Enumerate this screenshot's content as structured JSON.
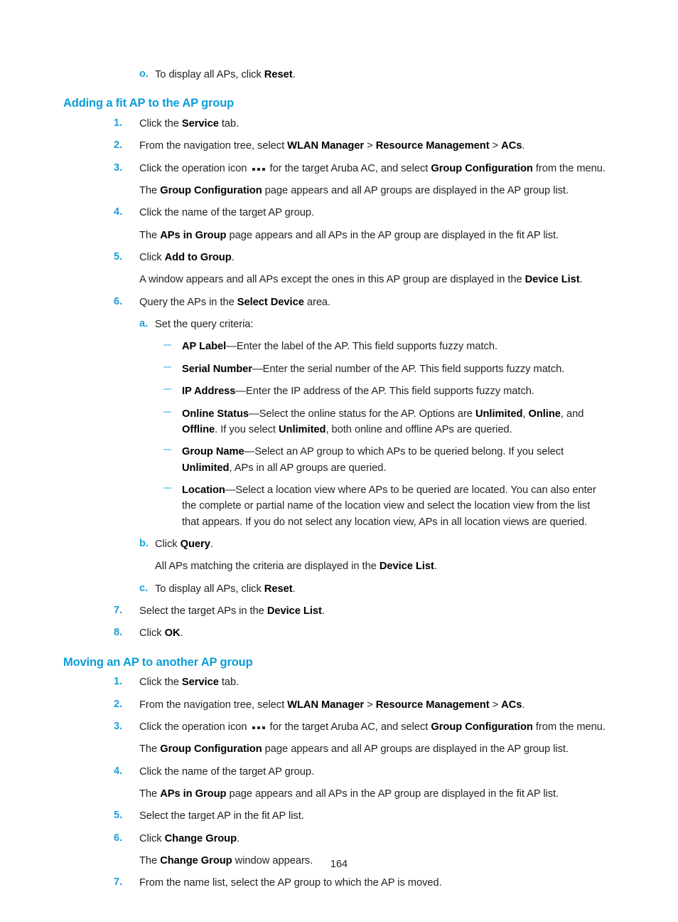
{
  "document": {
    "page_number": "164",
    "colors": {
      "heading_blue": "#0b9dd8",
      "marker_blue": "#1a9fd9",
      "dash_blue": "#8fd4ef",
      "body_text": "#231f20"
    }
  },
  "top_item": {
    "marker": "o.",
    "text_before": "To display all APs, click ",
    "bold_1": "Reset",
    "text_after": "."
  },
  "section_1": {
    "heading": "Adding a fit AP to the AP group",
    "steps": {
      "s1": {
        "marker": "1.",
        "t1": "Click the ",
        "b1": "Service",
        "t2": " tab."
      },
      "s2": {
        "marker": "2.",
        "t1": "From the navigation tree, select ",
        "b1": "WLAN Manager",
        "t2": " > ",
        "b2": "Resource Management",
        "t3": " > ",
        "b3": "ACs",
        "t4": "."
      },
      "s3": {
        "marker": "3.",
        "t1": "Click the operation icon ",
        "icon": "operation-icon",
        "t2": " for the target Aruba AC, and select ",
        "b1": "Group Configuration",
        "t3": " from the menu."
      },
      "s3_result": {
        "t1": "The ",
        "b1": "Group Configuration",
        "t2": " page appears and all AP groups are displayed in the AP group list."
      },
      "s4": {
        "marker": "4.",
        "t1": "Click the name of the target AP group."
      },
      "s4_result": {
        "t1": "The ",
        "b1": "APs in Group",
        "t2": " page appears and all APs in the AP group are displayed in the fit AP list."
      },
      "s5": {
        "marker": "5.",
        "t1": "Click ",
        "b1": "Add to Group",
        "t2": "."
      },
      "s5_result": {
        "t1": "A window appears and all APs except the ones in this AP group are displayed in the ",
        "b1": "Device List",
        "t2": "."
      },
      "s6": {
        "marker": "6.",
        "t1": "Query the APs in the ",
        "b1": "Select Device",
        "t2": " area."
      },
      "s6a": {
        "marker": "a.",
        "t1": "Set the query criteria:"
      },
      "criteria": [
        {
          "name": "ap-label",
          "b1": "AP Label",
          "t1": "—Enter the label of the AP. This field supports fuzzy match."
        },
        {
          "name": "serial-number",
          "b1": "Serial Number",
          "t1": "—Enter the serial number of the AP. This field supports fuzzy match."
        },
        {
          "name": "ip-address",
          "b1": "IP Address",
          "t1": "—Enter the IP address of the AP. This field supports fuzzy match."
        }
      ],
      "criteria_online_status": {
        "b1": "Online Status",
        "t1": "—Select the online status for the AP. Options are ",
        "b2": "Unlimited",
        "t2": ", ",
        "b3": "Online",
        "t3": ", and ",
        "b4": "Offline",
        "t4": ". If you select ",
        "b5": "Unlimited",
        "t5": ", both online and offline APs are queried."
      },
      "criteria_group_name": {
        "b1": "Group Name",
        "t1": "—Select an AP group to which APs to be queried belong. If you select ",
        "b2": "Unlimited",
        "t2": ", APs in all AP groups are queried."
      },
      "criteria_location": {
        "b1": "Location",
        "t1": "—Select a location view where APs to be queried are located. You can also enter the complete or partial name of the location view and select the location view from the list that appears. If you do not select any location view, APs in all location views are queried."
      },
      "s6b": {
        "marker": "b.",
        "t1": "Click ",
        "b1": "Query",
        "t2": "."
      },
      "s6b_result": {
        "t1": "All APs matching the criteria are displayed in the ",
        "b1": "Device List",
        "t2": "."
      },
      "s6c": {
        "marker": "c.",
        "t1": "To display all APs, click ",
        "b1": "Reset",
        "t2": "."
      },
      "s7": {
        "marker": "7.",
        "t1": "Select the target APs in the ",
        "b1": "Device List",
        "t2": "."
      },
      "s8": {
        "marker": "8.",
        "t1": "Click ",
        "b1": "OK",
        "t2": "."
      }
    }
  },
  "section_2": {
    "heading": "Moving an AP to another AP group",
    "steps": {
      "s1": {
        "marker": "1.",
        "t1": "Click the ",
        "b1": "Service",
        "t2": " tab."
      },
      "s2": {
        "marker": "2.",
        "t1": "From the navigation tree, select ",
        "b1": "WLAN Manager",
        "t2": " > ",
        "b2": "Resource Management",
        "t3": " > ",
        "b3": "ACs",
        "t4": "."
      },
      "s3": {
        "marker": "3.",
        "t1": "Click the operation icon ",
        "icon": "operation-icon",
        "t2": " for the target Aruba AC, and select ",
        "b1": "Group Configuration",
        "t3": " from the menu."
      },
      "s3_result": {
        "t1": "The ",
        "b1": "Group Configuration",
        "t2": " page appears and all AP groups are displayed in the AP group list."
      },
      "s4": {
        "marker": "4.",
        "t1": "Click the name of the target AP group."
      },
      "s4_result": {
        "t1": "The ",
        "b1": "APs in Group",
        "t2": " page appears and all APs in the AP group are displayed in the fit AP list."
      },
      "s5": {
        "marker": "5.",
        "t1": "Select the target AP in the fit AP list."
      },
      "s6": {
        "marker": "6.",
        "t1": "Click ",
        "b1": "Change Group",
        "t2": "."
      },
      "s6_result": {
        "t1": "The ",
        "b1": "Change Group",
        "t2": " window appears."
      },
      "s7": {
        "marker": "7.",
        "t1": "From the name list, select the AP group to which the AP is moved."
      }
    }
  }
}
